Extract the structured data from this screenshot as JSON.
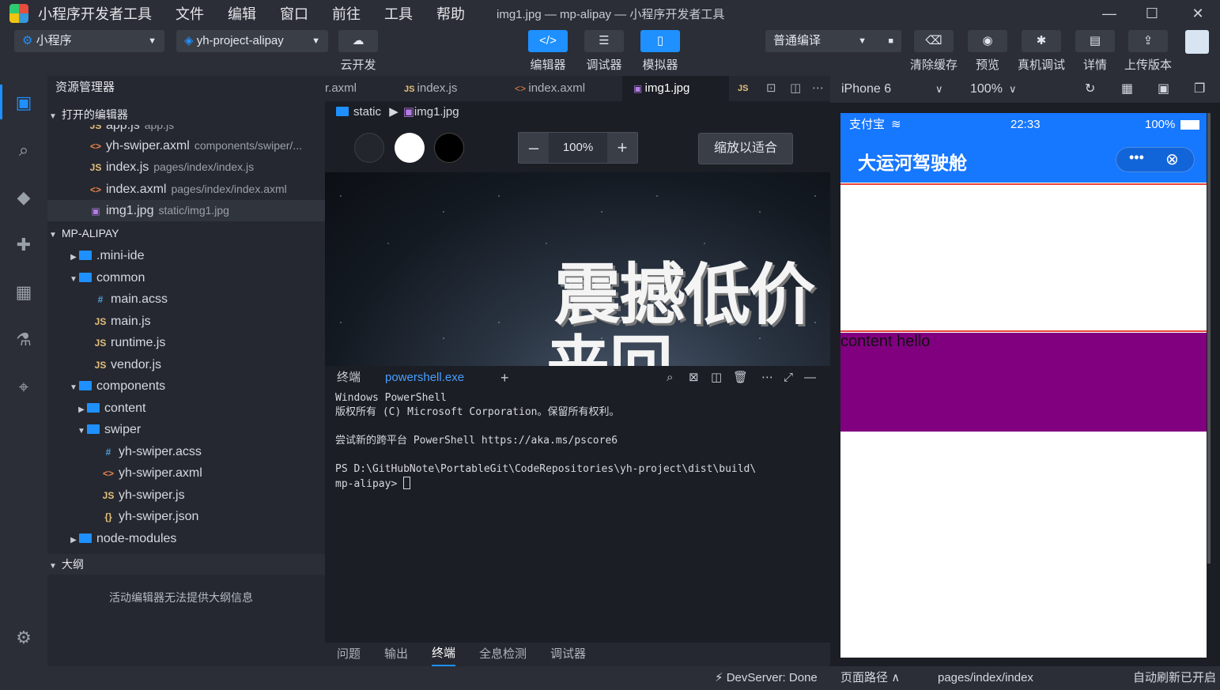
{
  "app": {
    "name": "小程序开发者工具",
    "window_title": "img1.jpg — mp-alipay — 小程序开发者工具",
    "menus": [
      "文件",
      "编辑",
      "窗口",
      "前往",
      "工具",
      "帮助"
    ]
  },
  "toolbar": {
    "mode": "小程序",
    "project": "yh-project-alipay",
    "cloud": "云开发",
    "editor": "编辑器",
    "debugger": "调试器",
    "simulator": "模拟器",
    "compile": "普通编译",
    "clear_cache": "清除缓存",
    "preview": "预览",
    "remote_debug": "真机调试",
    "details": "详情",
    "upload": "上传版本"
  },
  "sidebar": {
    "title": "资源管理器",
    "open_editors": "打开的编辑器",
    "open_items": [
      {
        "name": "app.js",
        "path": "app.js",
        "type": "js"
      },
      {
        "name": "yh-swiper.axml",
        "path": "components/swiper/...",
        "type": "xml"
      },
      {
        "name": "index.js",
        "path": "pages/index/index.js",
        "type": "js"
      },
      {
        "name": "index.axml",
        "path": "pages/index/index.axml",
        "type": "xml"
      },
      {
        "name": "img1.jpg",
        "path": "static/img1.jpg",
        "type": "img"
      }
    ],
    "project_title": "MP-ALIPAY",
    "tree": [
      {
        "name": ".mini-ide",
        "kind": "folder",
        "open": false
      },
      {
        "name": "common",
        "kind": "folder",
        "open": true
      },
      {
        "name": "main.acss",
        "kind": "css"
      },
      {
        "name": "main.js",
        "kind": "js"
      },
      {
        "name": "runtime.js",
        "kind": "js"
      },
      {
        "name": "vendor.js",
        "kind": "js"
      },
      {
        "name": "components",
        "kind": "folder",
        "open": true
      },
      {
        "name": "content",
        "kind": "folder",
        "open": false
      },
      {
        "name": "swiper",
        "kind": "folder",
        "open": true
      },
      {
        "name": "yh-swiper.acss",
        "kind": "css"
      },
      {
        "name": "yh-swiper.axml",
        "kind": "xml"
      },
      {
        "name": "yh-swiper.js",
        "kind": "js"
      },
      {
        "name": "yh-swiper.json",
        "kind": "json"
      },
      {
        "name": "node-modules",
        "kind": "folder",
        "open": false
      }
    ],
    "outline_title": "大纲",
    "outline_msg": "活动编辑器无法提供大纲信息"
  },
  "tabs": [
    {
      "label": "r.axml"
    },
    {
      "label": "index.js"
    },
    {
      "label": "index.axml"
    },
    {
      "label": "img1.jpg"
    }
  ],
  "breadcrumb": {
    "folder": "static",
    "file": "img1.jpg"
  },
  "image_viewer": {
    "zoom": "100%",
    "fit": "缩放以适合",
    "image_text_1": "震撼低价",
    "image_text_2": "来回"
  },
  "terminal": {
    "title": "终端",
    "shell": "powershell.exe",
    "lines": [
      "Windows PowerShell",
      "版权所有 (C) Microsoft Corporation。保留所有权利。",
      "",
      "尝试新的跨平台 PowerShell https://aka.ms/pscore6",
      "",
      "PS D:\\GitHubNote\\PortableGit\\CodeRepositories\\yh-project\\dist\\build\\",
      "mp-alipay> "
    ]
  },
  "bottom_tabs": [
    "问题",
    "输出",
    "终端",
    "全息检测",
    "调试器"
  ],
  "simulator": {
    "device": "iPhone 6",
    "zoom": "100%",
    "status_left": "支付宝",
    "status_time": "22:33",
    "status_battery": "100%",
    "nav_title": "大运河驾驶舱",
    "content_text": "content hello"
  },
  "statusbar": {
    "devserver": "DevServer: Done",
    "page_path_label": "页面路径",
    "page_path": "pages/index/index",
    "auto_refresh": "自动刷新已开启"
  }
}
